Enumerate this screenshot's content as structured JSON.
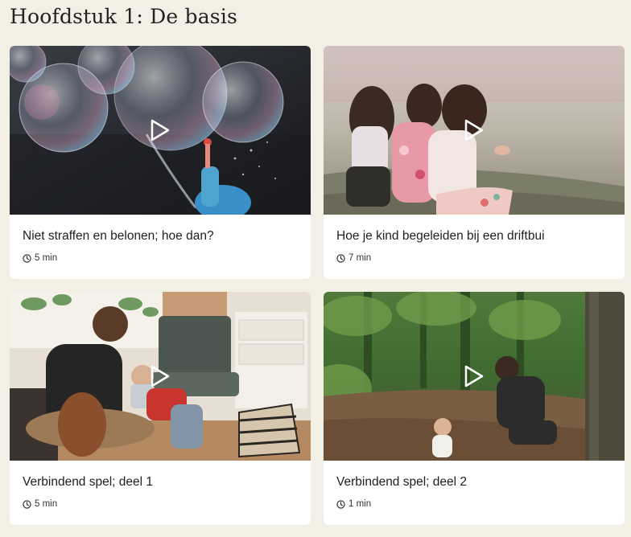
{
  "chapter": {
    "title": "Hoofdstuk 1: De basis"
  },
  "lessons": [
    {
      "title": "Niet straffen en belonen; hoe dan?",
      "duration": "5 min",
      "image": "bubbles-photo"
    },
    {
      "title": "Hoe je kind begeleiden bij een driftbui",
      "duration": "7 min",
      "image": "children-sitting-photo"
    },
    {
      "title": "Verbindend spel; deel 1",
      "duration": "5 min",
      "image": "father-guitar-child-photo"
    },
    {
      "title": "Verbindend spel; deel 2",
      "duration": "1 min",
      "image": "father-child-forest-photo"
    }
  ],
  "icons": {
    "play": "play-icon",
    "clock": "clock-icon"
  },
  "colors": {
    "background": "#f2efe5",
    "card": "#ffffff",
    "text": "#1f1f1f"
  }
}
